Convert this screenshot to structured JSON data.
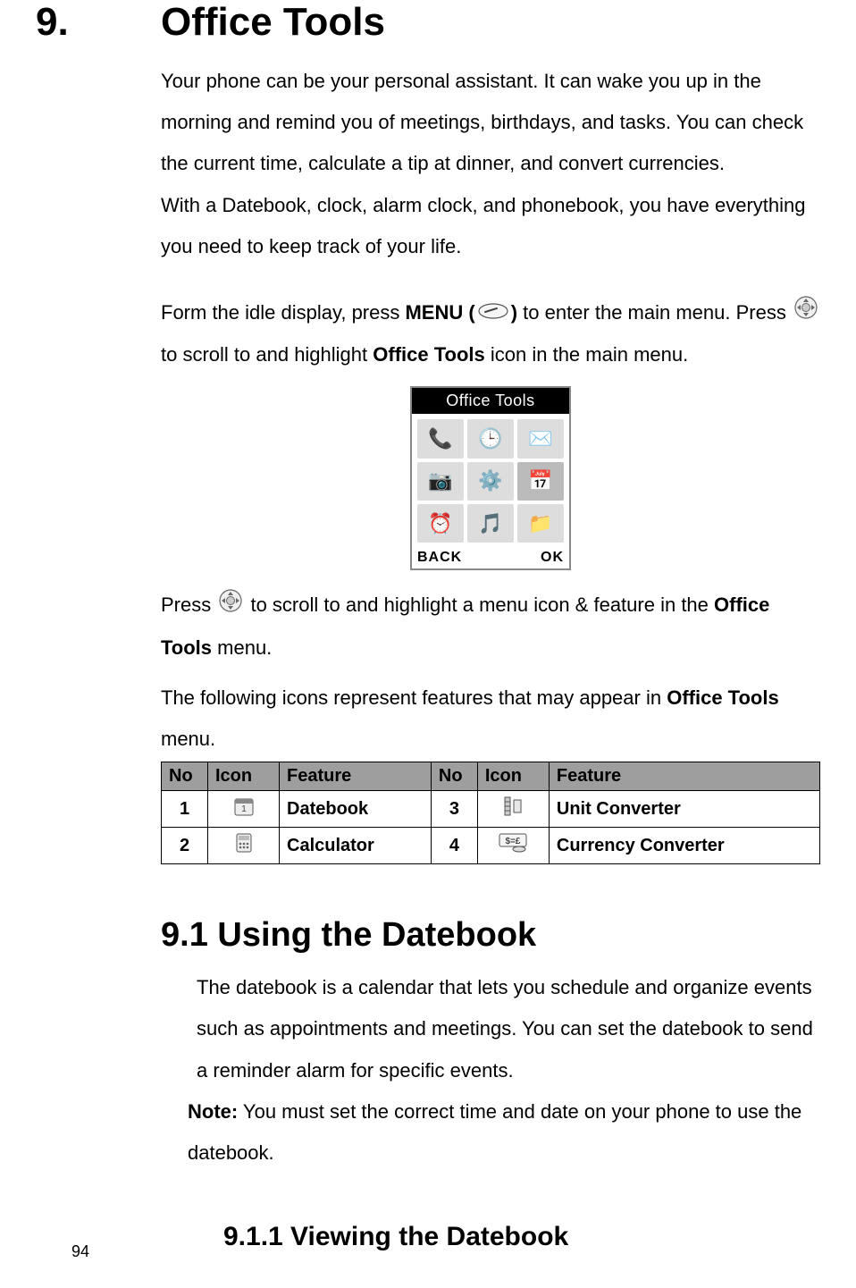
{
  "chapter": {
    "number": "9.",
    "title": "Office Tools"
  },
  "intro": {
    "p1": "Your phone can be your personal assistant. It can wake you up in the morning and remind you of meetings, birthdays, and tasks. You can check the current time, calculate a tip at dinner, and convert currencies.",
    "p2": "With a Datebook, clock, alarm clock, and phonebook, you have everything you need to keep track of your life."
  },
  "nav": {
    "pre1": "Form the idle display, press ",
    "menu_label": "MENU (",
    "menu_close": ")",
    "post1a": " to enter the main menu. Press ",
    "post1b": " to scroll to and highlight ",
    "office_tools": "Office Tools",
    "post1c": " icon in the main menu."
  },
  "phone_screen": {
    "title": "Office Tools",
    "back": "BACK",
    "ok": "OK"
  },
  "nav2": {
    "pre": "Press ",
    "mid": " to scroll to and highlight a menu icon & feature in the ",
    "office_tools": "Office Tools",
    "post": " menu."
  },
  "table_intro": {
    "pre": "The following icons represent features that may appear in ",
    "office_tools": "Office Tools",
    "post": " menu."
  },
  "table": {
    "headers": {
      "no": "No",
      "icon": "Icon",
      "feature": "Feature"
    },
    "rows": [
      {
        "noA": "1",
        "featureA": "Datebook",
        "noB": "3",
        "featureB": "Unit Converter"
      },
      {
        "noA": "2",
        "featureA": "Calculator",
        "noB": "4",
        "featureB": "Currency Converter"
      }
    ]
  },
  "section91": {
    "heading": "9.1  Using the Datebook",
    "p1": "The datebook is a calendar that lets you schedule and organize events such as appointments and meetings. You can set the datebook to send a reminder alarm for specific events.",
    "note_label": "Note:",
    "note_text": " You must set the correct time and date on your phone to use the datebook."
  },
  "section911": {
    "heading": "9.1.1   Viewing the Datebook"
  },
  "page_number": "94"
}
